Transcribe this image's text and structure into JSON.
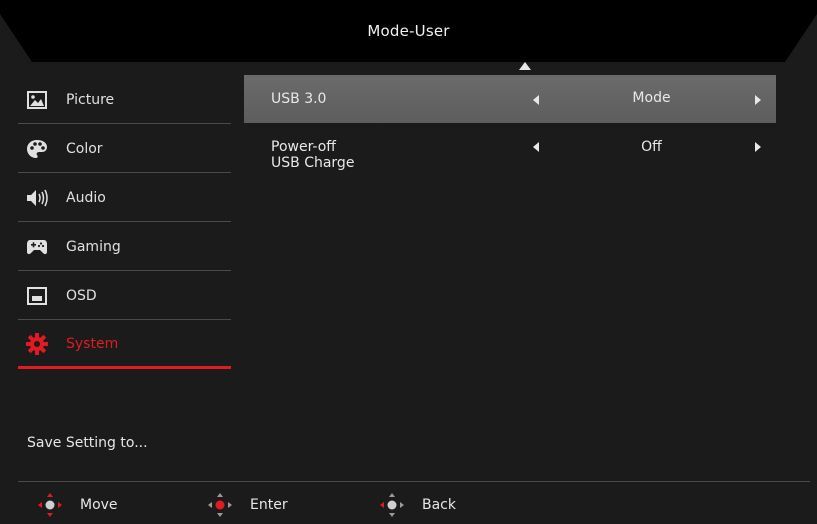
{
  "header": {
    "title": "Mode-User"
  },
  "sidebar": {
    "items": [
      {
        "label": "Picture",
        "icon": "picture-icon"
      },
      {
        "label": "Color",
        "icon": "palette-icon"
      },
      {
        "label": "Audio",
        "icon": "speaker-icon"
      },
      {
        "label": "Gaming",
        "icon": "gamepad-icon"
      },
      {
        "label": "OSD",
        "icon": "osd-icon"
      },
      {
        "label": "System",
        "icon": "gear-icon",
        "active": true
      }
    ],
    "save_label": "Save Setting to..."
  },
  "main": {
    "rows": [
      {
        "label": "USB 3.0",
        "value": "Mode",
        "selected": true
      },
      {
        "label_line1": "Power-off",
        "label_line2": "USB Charge",
        "value": "Off"
      }
    ]
  },
  "footer": {
    "move_label": "Move",
    "enter_label": "Enter",
    "back_label": "Back"
  },
  "colors": {
    "accent": "#e11b22",
    "background": "#1b1b1b",
    "selected_row": "#636363"
  }
}
